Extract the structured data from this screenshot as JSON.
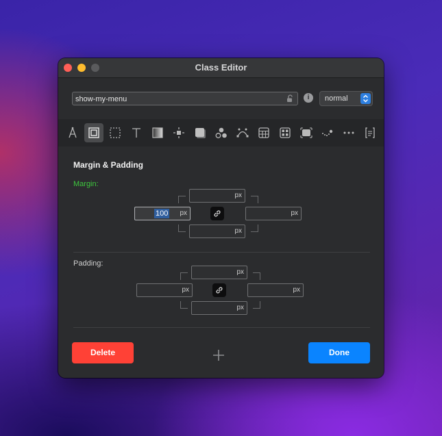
{
  "window": {
    "title": "Class Editor"
  },
  "class_field": {
    "value": "show-my-menu"
  },
  "info_icon": {
    "glyph": "i"
  },
  "state_select": {
    "value": "normal"
  },
  "toolbar": {
    "tools": [
      "typography-pen-icon",
      "box-model-icon",
      "border-dashed-icon",
      "text-icon",
      "gradient-icon",
      "position-icon",
      "shadow-icon",
      "circles-icon",
      "bezier-icon",
      "table-icon",
      "grid-icon",
      "media-icon",
      "path-icon",
      "more-icon",
      "code-icon"
    ],
    "active_index": 1
  },
  "section": {
    "title": "Margin & Padding"
  },
  "margin": {
    "label": "Margin:",
    "top": {
      "value": "",
      "unit": "px"
    },
    "left": {
      "value": "100",
      "unit": "px"
    },
    "right": {
      "value": "",
      "unit": "px"
    },
    "bottom": {
      "value": "",
      "unit": "px"
    }
  },
  "padding": {
    "label": "Padding:",
    "top": {
      "value": "",
      "unit": "px"
    },
    "left": {
      "value": "",
      "unit": "px"
    },
    "right": {
      "value": "",
      "unit": "px"
    },
    "bottom": {
      "value": "",
      "unit": "px"
    }
  },
  "footer": {
    "delete_label": "Delete",
    "done_label": "Done"
  },
  "colors": {
    "delete": "#ff4136",
    "done": "#0a84ff",
    "margin_label": "#3ec83e"
  }
}
